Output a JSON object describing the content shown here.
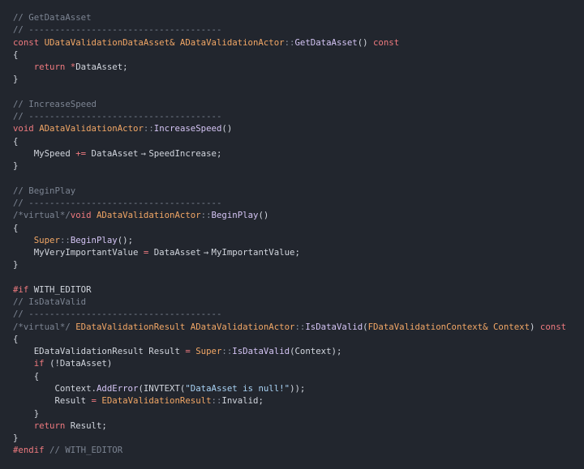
{
  "code_lines": [
    [
      [
        "c",
        "// GetDataAsset"
      ]
    ],
    [
      [
        "c",
        "// -------------------------------------"
      ]
    ],
    [
      [
        "k",
        "const "
      ],
      [
        "t",
        "UDataValidationDataAsset& ADataValidationActor"
      ],
      [
        "n",
        "::"
      ],
      [
        "f",
        "GetDataAsset"
      ],
      [
        "p",
        "() "
      ],
      [
        "k",
        "const"
      ]
    ],
    [
      [
        "p",
        "{"
      ]
    ],
    [
      [
        "p",
        "    "
      ],
      [
        "k",
        "return "
      ],
      [
        "o",
        "*"
      ],
      [
        "p",
        "DataAsset;"
      ]
    ],
    [
      [
        "p",
        "}"
      ]
    ],
    [],
    [
      [
        "c",
        "// IncreaseSpeed"
      ]
    ],
    [
      [
        "c",
        "// -------------------------------------"
      ]
    ],
    [
      [
        "k",
        "void "
      ],
      [
        "t",
        "ADataValidationActor"
      ],
      [
        "n",
        "::"
      ],
      [
        "f",
        "IncreaseSpeed"
      ],
      [
        "p",
        "()"
      ]
    ],
    [
      [
        "p",
        "{"
      ]
    ],
    [
      [
        "p",
        "    MySpeed "
      ],
      [
        "o",
        "+="
      ],
      [
        "p",
        " DataAsset"
      ],
      [
        "a",
        "→"
      ],
      [
        "p",
        "SpeedIncrease;"
      ]
    ],
    [
      [
        "p",
        "}"
      ]
    ],
    [],
    [
      [
        "c",
        "// BeginPlay"
      ]
    ],
    [
      [
        "c",
        "// -------------------------------------"
      ]
    ],
    [
      [
        "c",
        "/*virtual*/"
      ],
      [
        "k",
        "void "
      ],
      [
        "t",
        "ADataValidationActor"
      ],
      [
        "n",
        "::"
      ],
      [
        "f",
        "BeginPlay"
      ],
      [
        "p",
        "()"
      ]
    ],
    [
      [
        "p",
        "{"
      ]
    ],
    [
      [
        "p",
        "    "
      ],
      [
        "t",
        "Super"
      ],
      [
        "n",
        "::"
      ],
      [
        "f",
        "BeginPlay"
      ],
      [
        "p",
        "();"
      ]
    ],
    [
      [
        "p",
        "    MyVeryImportantValue "
      ],
      [
        "o",
        "="
      ],
      [
        "p",
        " DataAsset"
      ],
      [
        "a",
        "→"
      ],
      [
        "p",
        "MyImportantValue;"
      ]
    ],
    [
      [
        "p",
        "}"
      ]
    ],
    [],
    [
      [
        "k",
        "#if "
      ],
      [
        "p",
        "WITH_EDITOR"
      ]
    ],
    [
      [
        "c",
        "// IsDataValid"
      ]
    ],
    [
      [
        "c",
        "// -------------------------------------"
      ]
    ],
    [
      [
        "c",
        "/*virtual*/ "
      ],
      [
        "t",
        "EDataValidationResult ADataValidationActor"
      ],
      [
        "n",
        "::"
      ],
      [
        "f",
        "IsDataValid"
      ],
      [
        "p",
        "("
      ],
      [
        "t",
        "FDataValidationContext& Context"
      ],
      [
        "p",
        ") "
      ],
      [
        "k",
        "const"
      ]
    ],
    [
      [
        "p",
        "{"
      ]
    ],
    [
      [
        "p",
        "    EDataValidationResult Result "
      ],
      [
        "o",
        "="
      ],
      [
        "p",
        " "
      ],
      [
        "t",
        "Super"
      ],
      [
        "n",
        "::"
      ],
      [
        "f",
        "IsDataValid"
      ],
      [
        "p",
        "(Context);"
      ]
    ],
    [
      [
        "p",
        "    "
      ],
      [
        "k",
        "if "
      ],
      [
        "p",
        "(!DataAsset)"
      ]
    ],
    [
      [
        "p",
        "    {"
      ]
    ],
    [
      [
        "p",
        "        Context."
      ],
      [
        "f",
        "AddError"
      ],
      [
        "p",
        "(INVTEXT("
      ],
      [
        "s",
        "\"DataAsset is null!\""
      ],
      [
        "p",
        "));"
      ]
    ],
    [
      [
        "p",
        "        Result "
      ],
      [
        "o",
        "="
      ],
      [
        "p",
        " "
      ],
      [
        "t",
        "EDataValidationResult"
      ],
      [
        "n",
        "::"
      ],
      [
        "p",
        "Invalid;"
      ]
    ],
    [
      [
        "p",
        "    }"
      ]
    ],
    [
      [
        "p",
        "    "
      ],
      [
        "k",
        "return "
      ],
      [
        "p",
        "Result;"
      ]
    ],
    [
      [
        "p",
        "}"
      ]
    ],
    [
      [
        "k",
        "#endif "
      ],
      [
        "c",
        "// WITH_EDITOR"
      ]
    ]
  ]
}
